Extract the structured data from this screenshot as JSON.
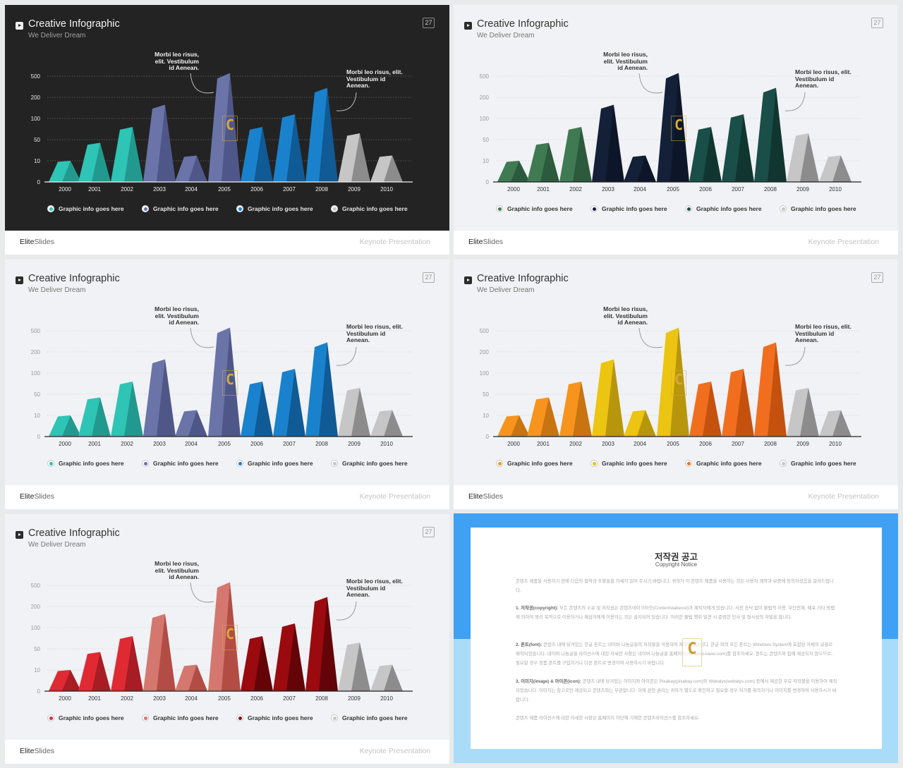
{
  "slide_common": {
    "title": "Creative Infographic",
    "subtitle": "We Deliver Dream",
    "page_number": "27",
    "annotation_1": "Morbi leo risus, elit. Vestibulum id Aenean.",
    "annotation_2": "Morbi leo risus, elit. Vestibulum id Aenean.",
    "footer_brand_bold": "Elite",
    "footer_brand_light": "Slides",
    "footer_right": "Keynote Presentation",
    "watermark_letter": "C",
    "legend_labels": [
      "Graphic info goes here",
      "Graphic info goes here",
      "Graphic info goes here",
      "Graphic info goes here"
    ]
  },
  "chart_data": [
    {
      "type": "bar",
      "variant": "3d-triangular-bar",
      "theme": "dark",
      "categories": [
        "2000",
        "2001",
        "2002",
        "2003",
        "2004",
        "2005",
        "2006",
        "2007",
        "2008",
        "2009",
        "2010"
      ],
      "values": [
        10,
        44,
        80,
        165,
        20,
        545,
        80,
        120,
        335,
        65,
        20
      ],
      "y_ticks": [
        0,
        10,
        50,
        100,
        200,
        500
      ],
      "y_scale": "piecewise-even-ticks",
      "grid": true,
      "series_groups": [
        {
          "name": "Graphic info goes here",
          "categories": [
            "2000",
            "2001",
            "2002"
          ],
          "color": "#2ec4b6",
          "shade": "#22998e"
        },
        {
          "name": "Graphic info goes here",
          "categories": [
            "2003",
            "2004",
            "2005"
          ],
          "color": "#6b74a8",
          "shade": "#4f5789"
        },
        {
          "name": "Graphic info goes here",
          "categories": [
            "2006",
            "2007",
            "2008"
          ],
          "color": "#1a82cc",
          "shade": "#105a96"
        },
        {
          "name": "Graphic info goes here",
          "categories": [
            "2009",
            "2010"
          ],
          "color": "#c6c6c6",
          "shade": "#8c8c8c"
        }
      ],
      "legend": "bottom"
    },
    {
      "type": "bar",
      "variant": "3d-triangular-bar",
      "theme": "light",
      "categories": [
        "2000",
        "2001",
        "2002",
        "2003",
        "2004",
        "2005",
        "2006",
        "2007",
        "2008",
        "2009",
        "2010"
      ],
      "values": [
        10,
        44,
        80,
        165,
        20,
        545,
        80,
        120,
        335,
        65,
        20
      ],
      "y_ticks": [
        0,
        10,
        50,
        100,
        200,
        500
      ],
      "y_scale": "piecewise-even-ticks",
      "grid": true,
      "series_groups": [
        {
          "name": "Graphic info goes here",
          "categories": [
            "2000",
            "2001",
            "2002"
          ],
          "color": "#3f7a52",
          "shade": "#2c5a3c"
        },
        {
          "name": "Graphic info goes here",
          "categories": [
            "2003",
            "2004",
            "2005"
          ],
          "color": "#132038",
          "shade": "#0c1628"
        },
        {
          "name": "Graphic info goes here",
          "categories": [
            "2006",
            "2007",
            "2008"
          ],
          "color": "#1a4e48",
          "shade": "#10362f"
        },
        {
          "name": "Graphic info goes here",
          "categories": [
            "2009",
            "2010"
          ],
          "color": "#c6c6c6",
          "shade": "#8c8c8c"
        }
      ],
      "legend": "bottom"
    },
    {
      "type": "bar",
      "variant": "3d-triangular-bar",
      "theme": "light",
      "categories": [
        "2000",
        "2001",
        "2002",
        "2003",
        "2004",
        "2005",
        "2006",
        "2007",
        "2008",
        "2009",
        "2010"
      ],
      "values": [
        10,
        44,
        80,
        165,
        20,
        545,
        80,
        120,
        335,
        65,
        20
      ],
      "y_ticks": [
        0,
        10,
        50,
        100,
        200,
        500
      ],
      "y_scale": "piecewise-even-ticks",
      "grid": true,
      "series_groups": [
        {
          "name": "Graphic info goes here",
          "categories": [
            "2000",
            "2001",
            "2002"
          ],
          "color": "#2ec4b6",
          "shade": "#22998e"
        },
        {
          "name": "Graphic info goes here",
          "categories": [
            "2003",
            "2004",
            "2005"
          ],
          "color": "#6b74a8",
          "shade": "#4f5789"
        },
        {
          "name": "Graphic info goes here",
          "categories": [
            "2006",
            "2007",
            "2008"
          ],
          "color": "#1a82cc",
          "shade": "#105a96"
        },
        {
          "name": "Graphic info goes here",
          "categories": [
            "2009",
            "2010"
          ],
          "color": "#c6c6c6",
          "shade": "#8c8c8c"
        }
      ],
      "legend": "bottom"
    },
    {
      "type": "bar",
      "variant": "3d-triangular-bar",
      "theme": "light",
      "categories": [
        "2000",
        "2001",
        "2002",
        "2003",
        "2004",
        "2005",
        "2006",
        "2007",
        "2008",
        "2009",
        "2010"
      ],
      "values": [
        10,
        44,
        80,
        165,
        20,
        545,
        80,
        120,
        335,
        65,
        20
      ],
      "y_ticks": [
        0,
        10,
        50,
        100,
        200,
        500
      ],
      "y_scale": "piecewise-even-ticks",
      "grid": true,
      "series_groups": [
        {
          "name": "Graphic info goes here",
          "categories": [
            "2000",
            "2001",
            "2002"
          ],
          "color": "#f7941d",
          "shade": "#c87410"
        },
        {
          "name": "Graphic info goes here",
          "categories": [
            "2003",
            "2004",
            "2005"
          ],
          "color": "#ecc412",
          "shade": "#b8960c"
        },
        {
          "name": "Graphic info goes here",
          "categories": [
            "2006",
            "2007",
            "2008"
          ],
          "color": "#f26e1f",
          "shade": "#c4520e"
        },
        {
          "name": "Graphic info goes here",
          "categories": [
            "2009",
            "2010"
          ],
          "color": "#c6c6c6",
          "shade": "#8c8c8c"
        }
      ],
      "legend": "bottom"
    },
    {
      "type": "bar",
      "variant": "3d-triangular-bar",
      "theme": "light",
      "categories": [
        "2000",
        "2001",
        "2002",
        "2003",
        "2004",
        "2005",
        "2006",
        "2007",
        "2008",
        "2009",
        "2010"
      ],
      "values": [
        10,
        44,
        80,
        165,
        20,
        545,
        80,
        120,
        335,
        65,
        20
      ],
      "y_ticks": [
        0,
        10,
        50,
        100,
        200,
        500
      ],
      "y_scale": "piecewise-even-ticks",
      "grid": true,
      "series_groups": [
        {
          "name": "Graphic info goes here",
          "categories": [
            "2000",
            "2001",
            "2002"
          ],
          "color": "#e02a33",
          "shade": "#a81c24"
        },
        {
          "name": "Graphic info goes here",
          "categories": [
            "2003",
            "2004",
            "2005"
          ],
          "color": "#d4776f",
          "shade": "#b24c44"
        },
        {
          "name": "Graphic info goes here",
          "categories": [
            "2006",
            "2007",
            "2008"
          ],
          "color": "#9a0a0f",
          "shade": "#640408"
        },
        {
          "name": "Graphic info goes here",
          "categories": [
            "2009",
            "2010"
          ],
          "color": "#c6c6c6",
          "shade": "#8c8c8c"
        }
      ],
      "legend": "bottom"
    }
  ],
  "notice": {
    "title": "저작권 공고",
    "subtitle": "Copyright Notice",
    "intro": "콘텐츠 제품을 사용하기 전에 다음의 협약과 조항들을 자세히 읽어 주시기 바랍니다. 귀하가 이 콘텐츠 제품을 사용하는 것은 사용자 계약과 보증에 동의하셨음을 알려드립니다.",
    "items": [
      {
        "heading": "1. 저작권(copyright):",
        "body": " 모든 콘텐츠의 소유 및 저작권은 콘텐츠테이크아웃(Contentstakeout)과 제작자에게 있습니다. 사전 승낙 없이 불법적 이용, 무단전재, 배포 기타 방법에 의하여 영리 목적으로 이용하거나 제삼자에게 이용하는 것은 금지되어 있습니다. 이러한 불법 행위 발견 시 준엄한 민사 및 형사상의 처벌을 합니다."
      },
      {
        "heading": "2. 폰트(font):",
        "body": " 콘텐츠 내에 담겨있는 한글 폰트는 네이버 나눔글꼴의 저작물을 이용하여 제작되었습니다. 한글 외의 모든 폰트는 Windows System에 포함된 자체의 글꼴로 제작되었습니다. 네이버 나눔글꼴 라이선스에 대한 자세한 사항은 네이버 나눔글꼴 홈페이지(hangeul.naver.com)를 참조하세요. 폰트는 콘텐츠와 함께 제공되지 않으므로, 필요할 경우 정품 폰트를 구입하거나 다른 폰트로 변경하여 사용하시기 바랍니다."
      },
      {
        "heading": "3. 이미지(image) & 아이콘(icon):",
        "body": " 콘텐츠 내에 담겨있는 이미지와 아이콘은 Pixabay(pixabay.com)와 Webalys(webalys.com) 등에서 제공한 무료 저작물을 이용하여 제작되었습니다. 이미지는 참고로만 제공되고 콘텐츠와는 무관합니다. 이에 관한 권리는 귀하가 별도로 확인하고 필요할 경우 허가를 취득하거나 이미지를 변경하여 사용하시기 바랍니다."
      }
    ],
    "closing": "콘텐츠 제품 라이선스에 대한 자세한 사항은 홈페이지 하단에 기재한 콘텐츠라이선스를 참조하세요.",
    "watermark_letter": "C"
  }
}
